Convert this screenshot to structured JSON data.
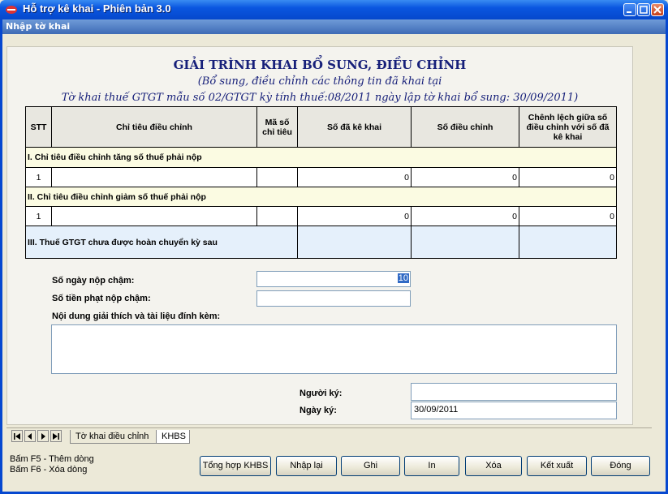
{
  "window": {
    "title": "Hỗ trợ kê khai - Phiên bản 3.0",
    "subheader": "Nhập tờ khai"
  },
  "form": {
    "title": "GIẢI TRÌNH KHAI BỔ SUNG, ĐIỀU CHỈNH",
    "subtitle1": "(Bổ sung, điều chỉnh các thông tin đã khai tại",
    "subtitle2": "Tờ khai thuế GTGT mẫu số 02/GTGT kỳ tính thuế:08/2011 ngày lập tờ khai bổ sung: 30/09/2011)"
  },
  "table": {
    "headers": {
      "stt": "STT",
      "chi_tieu": "Chỉ tiêu điều chỉnh",
      "ma_so": "Mã số chỉ tiêu",
      "so_da_ke_khai": "Số đã kê khai",
      "so_dieu_chinh": "Số điều chỉnh",
      "chenh_lech": "Chênh lệch giữa số điều chỉnh với số đã kê khai"
    },
    "section1": "I. Chỉ tiêu điều chỉnh tăng số thuế phải nộp",
    "row1": {
      "stt": "1",
      "chi_tieu": "",
      "ma_so": "",
      "so_da_ke_khai": "0",
      "so_dieu_chinh": "0",
      "chenh_lech": "0"
    },
    "section2": "II. Chỉ tiêu điều chỉnh giảm số thuế phải nộp",
    "row2": {
      "stt": "1",
      "chi_tieu": "",
      "ma_so": "",
      "so_da_ke_khai": "0",
      "so_dieu_chinh": "0",
      "chenh_lech": "0"
    },
    "section3": "III. Thuế GTGT chưa được hoàn chuyển kỳ sau"
  },
  "fields": {
    "so_ngay_label": "Số ngày nộp chậm:",
    "so_ngay_value": "10",
    "so_tien_label": "Số tiền phạt nộp chậm:",
    "so_tien_value": "",
    "noi_dung_label": "Nội dung giải thích và tài liệu đính kèm:",
    "noi_dung_value": "",
    "nguoi_ky_label": "Người ký:",
    "nguoi_ky_value": "",
    "ngay_ky_label": "Ngày ký:",
    "ngay_ky_value": "30/09/2011"
  },
  "tabs": {
    "tab1": "Tờ khai điều chỉnh",
    "tab2": "KHBS"
  },
  "status": {
    "line1": "Bấm F5 - Thêm dòng",
    "line2": "Bấm F6 - Xóa dòng"
  },
  "buttons": {
    "tong_hop": "Tổng hợp KHBS",
    "nhap_lai": "Nhập lại",
    "ghi": "Ghi",
    "in": "In",
    "xoa": "Xóa",
    "ket_xuat": "Kết xuất",
    "dong": "Đóng"
  }
}
